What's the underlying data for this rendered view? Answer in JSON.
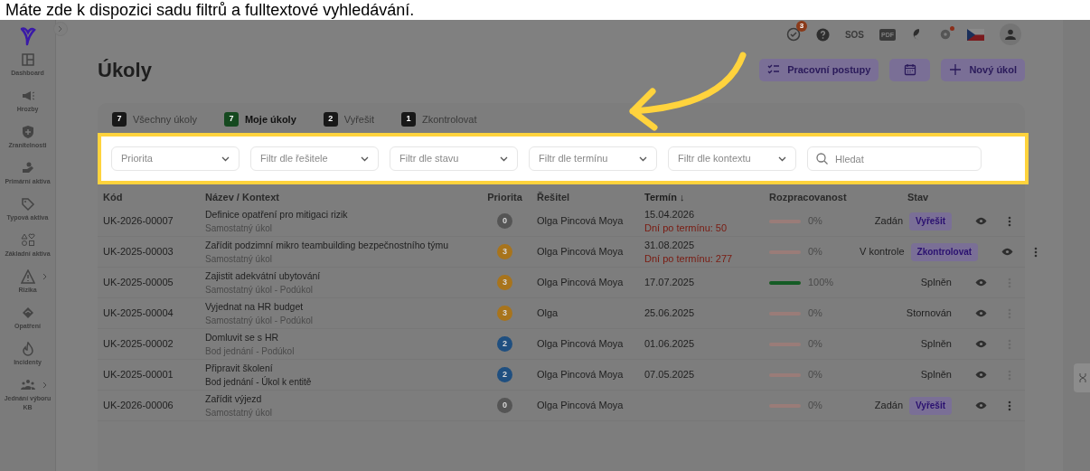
{
  "caption": "Máte zde k dispozici sadu filtrů a fulltextové vyhledávání.",
  "sidebar": {
    "items": [
      {
        "label": "Dashboard",
        "expandable": false
      },
      {
        "label": "Hrozby",
        "expandable": false
      },
      {
        "label": "Zranitelnosti",
        "expandable": false
      },
      {
        "label": "Primární aktiva",
        "expandable": false
      },
      {
        "label": "Typová aktiva",
        "expandable": false
      },
      {
        "label": "Základní aktiva",
        "expandable": false
      },
      {
        "label": "Rizika",
        "expandable": true
      },
      {
        "label": "Opatření",
        "expandable": false
      },
      {
        "label": "Incidenty",
        "expandable": false
      },
      {
        "label": "Jednání výboru KB",
        "expandable": true
      }
    ]
  },
  "topbar": {
    "task_badge": "3",
    "sos": "SOS",
    "pdf": "PDF"
  },
  "page": {
    "title": "Úkoly",
    "buttons": [
      {
        "kind": "text",
        "label": "Pracovní postupy"
      },
      {
        "kind": "icon"
      },
      {
        "kind": "text",
        "label": "Nový úkol"
      }
    ]
  },
  "tabs": [
    {
      "count": "7",
      "label": "Všechny úkoly",
      "selected": false
    },
    {
      "count": "7",
      "label": "Moje úkoly",
      "selected": true
    },
    {
      "count": "2",
      "label": "Vyřešit",
      "selected": false
    },
    {
      "count": "1",
      "label": "Zkontrolovat",
      "selected": false
    }
  ],
  "filters": [
    {
      "placeholder": "Priorita"
    },
    {
      "placeholder": "Filtr dle řešitele"
    },
    {
      "placeholder": "Filtr dle stavu"
    },
    {
      "placeholder": "Filtr dle termínu"
    },
    {
      "placeholder": "Filtr dle kontextu"
    }
  ],
  "search": {
    "placeholder": "Hledat"
  },
  "table": {
    "columns": [
      "Kód",
      "Název / Kontext",
      "Priorita",
      "Řešitel",
      "Termín ↓",
      "Rozpracovanost",
      "Stav"
    ],
    "rows": [
      {
        "code": "UK-2026-00007",
        "name": "Definice opatření pro mitigaci rizik",
        "context": "Samostatný úkol",
        "context_dark": false,
        "priority": "0",
        "color": "#555555",
        "resolver": "Olga Pincová Moya",
        "deadline": "15.04.2026",
        "overdue": "Dní po termínu: 50",
        "level": 0,
        "progress": "0%",
        "status": "Zadán",
        "action": "Vyřešit",
        "menu_enabled": true
      },
      {
        "code": "UK-2025-00003",
        "name": "Zařídit podzimní mikro teambuilding bezpečnostního týmu",
        "context": "Samostatný úkol",
        "context_dark": false,
        "priority": "3",
        "color": "#a8741c",
        "resolver": "Olga Pincová Moya",
        "deadline": "31.08.2025",
        "overdue": "Dní po termínu: 277",
        "level": 0,
        "progress": "0%",
        "status": "V kontrole",
        "action": "Zkontrolovat",
        "menu_enabled": true
      },
      {
        "code": "UK-2025-00005",
        "name": "Zajistit adekvátní ubytování",
        "context": "Samostatný úkol - Podúkol",
        "context_dark": false,
        "priority": "3",
        "color": "#a8741c",
        "resolver": "Olga Pincová Moya",
        "deadline": "17.07.2025",
        "level": 1,
        "progress": "100%",
        "status": "Splněn",
        "menu_enabled": false
      },
      {
        "code": "UK-2025-00004",
        "name": "Vyjednat na HR budget",
        "context": "Samostatný úkol - Podúkol",
        "context_dark": false,
        "priority": "3",
        "color": "#a8741c",
        "resolver": "Olga",
        "deadline": "25.06.2025",
        "level": 0,
        "progress": "0%",
        "status": "Stornován",
        "menu_enabled": false
      },
      {
        "code": "UK-2025-00002",
        "name": "Domluvit se s HR",
        "context": "Bod jednání - Podúkol",
        "context_dark": false,
        "priority": "2",
        "color": "#1f4f80",
        "resolver": "Olga Pincová Moya",
        "deadline": "01.06.2025",
        "level": 0,
        "progress": "0%",
        "status": "Splněn",
        "menu_enabled": false
      },
      {
        "code": "UK-2025-00001",
        "name": "Připravit školení",
        "context": "Bod jednání - Úkol k entitě",
        "context_dark": true,
        "priority": "2",
        "color": "#1f4f80",
        "resolver": "Olga Pincová Moya",
        "deadline": "07.05.2025",
        "level": 0,
        "progress": "0%",
        "status": "Splněn",
        "menu_enabled": false
      },
      {
        "code": "UK-2026-00006",
        "name": "Zařídit výjezd",
        "context": "Samostatný úkol",
        "context_dark": false,
        "priority": "0",
        "color": "#555555",
        "resolver": "Olga Pincová Moya",
        "level": 0,
        "progress": "0%",
        "status": "Zadán",
        "action": "Vyřešit",
        "menu_enabled": true
      }
    ]
  }
}
